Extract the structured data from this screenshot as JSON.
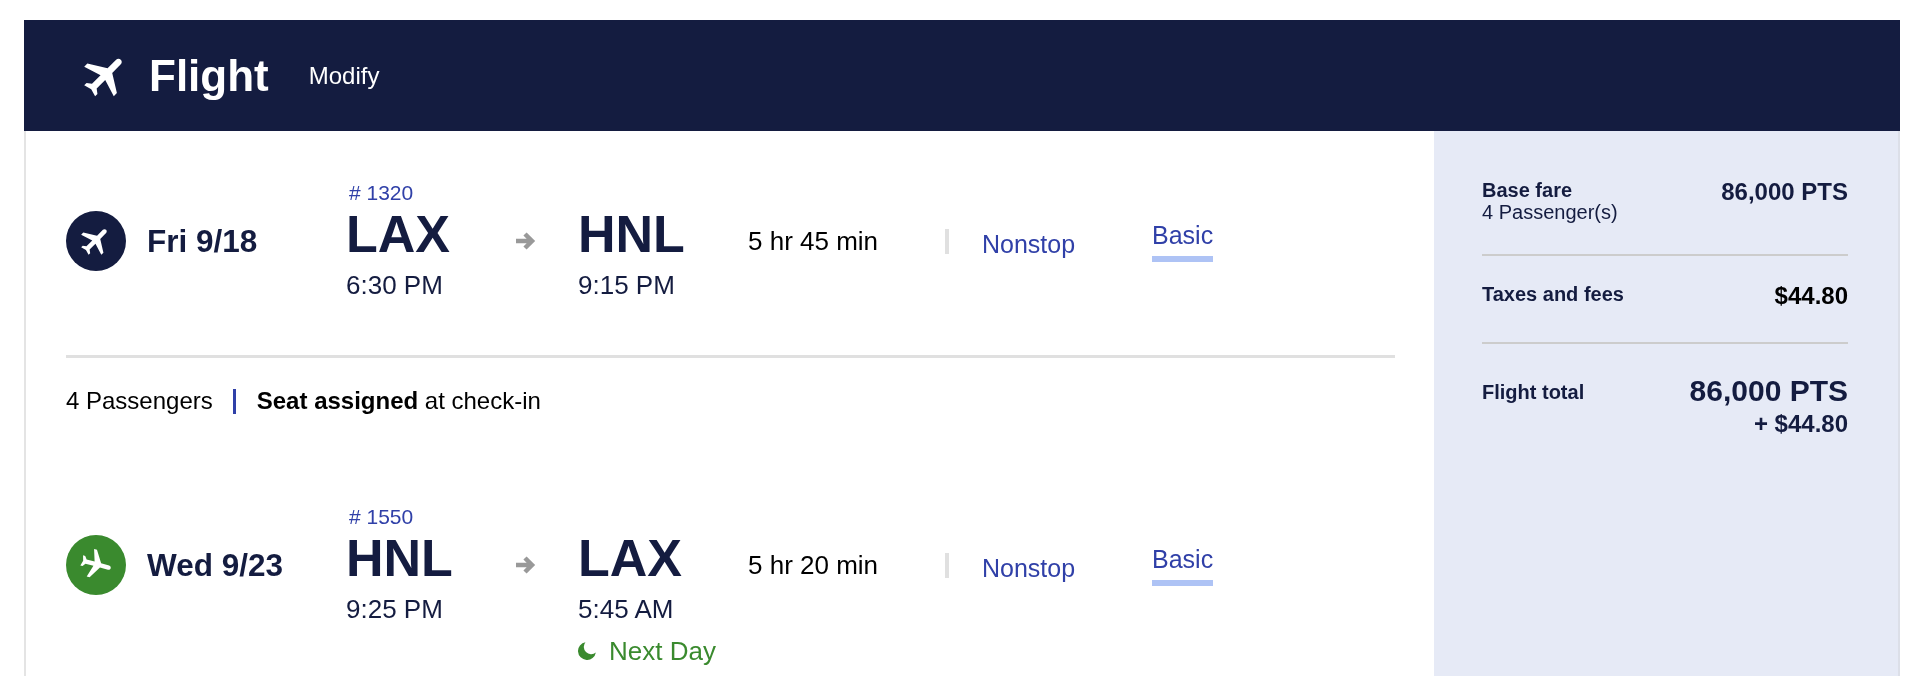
{
  "header": {
    "title": "Flight",
    "action": "Modify"
  },
  "itinerary": [
    {
      "kind": "outbound",
      "color": "#141c40",
      "date": "Fri 9/18",
      "flight_number": "# 1320",
      "origin": "LAX",
      "departure_time": "6:30 PM",
      "destination": "HNL",
      "arrival_time": "9:15 PM",
      "duration": "5 hr 45 min",
      "stops": "Nonstop",
      "fare": "Basic"
    },
    {
      "kind": "passengers",
      "count": "4 Passengers",
      "seating": "**Seat assigned** at check-in"
    },
    {
      "kind": "return",
      "color": "#3a8a2e",
      "date": "Wed 9/23",
      "flight_number": "# 1550",
      "origin": "HNL",
      "departure_time": "9:25 PM",
      "destination": "LAX",
      "arrival_time": "5:45 AM",
      "arrival_note": "Next Day",
      "duration": "5 hr 20 min",
      "stops": "Nonstop",
      "fare": "Basic"
    }
  ],
  "price_summary": {
    "lines": [
      {
        "kind": "points",
        "label": "Base fare",
        "note": "4 Passenger(s)",
        "amount": "86,000 PTS"
      },
      {
        "kind": "cash",
        "label": "Taxes and fees",
        "amount": "$44.80"
      }
    ],
    "total": {
      "label": "Flight total",
      "amount": "86,000 PTS",
      "extra": "+ $44.80"
    }
  }
}
